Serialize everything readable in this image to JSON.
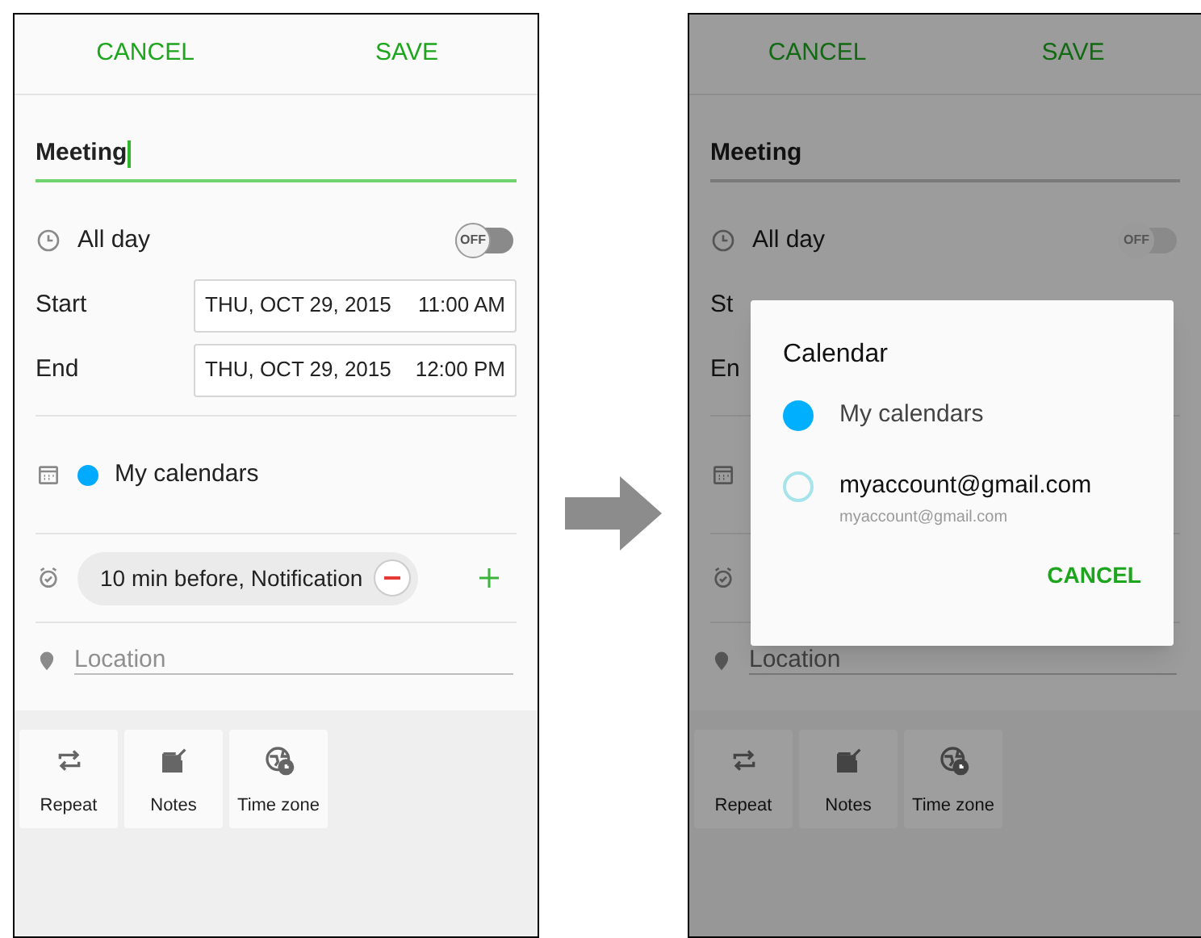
{
  "screens": [
    {
      "dimmed": false,
      "header": {
        "cancel": "CANCEL",
        "save": "SAVE"
      },
      "title": {
        "value": "Meeting",
        "focused": true
      },
      "all_day": {
        "label": "All day",
        "on": false,
        "toggle_text": "OFF"
      },
      "start": {
        "label": "Start",
        "date": "THU, OCT 29, 2015",
        "time": "11:00 AM"
      },
      "end": {
        "label": "End",
        "date": "THU, OCT 29, 2015",
        "time": "12:00 PM"
      },
      "calendar": {
        "label": "My calendars"
      },
      "reminder": {
        "text": "10 min before, Notification"
      },
      "location": {
        "placeholder": "Location"
      },
      "options": [
        {
          "label": "Repeat",
          "kind": "repeat"
        },
        {
          "label": "Notes",
          "kind": "notes"
        },
        {
          "label": "Time zone",
          "kind": "timezone"
        }
      ]
    },
    {
      "dimmed": true,
      "header": {
        "cancel": "CANCEL",
        "save": "SAVE"
      },
      "title": {
        "value": "Meeting",
        "focused": false
      },
      "all_day": {
        "label": "All day",
        "on": false,
        "toggle_text": "OFF"
      },
      "start": {
        "label": "St"
      },
      "end": {
        "label": "En"
      },
      "location": {
        "placeholder": "Location"
      },
      "options": [
        {
          "label": "Repeat",
          "kind": "repeat"
        },
        {
          "label": "Notes",
          "kind": "notes"
        },
        {
          "label": "Time zone",
          "kind": "timezone"
        }
      ],
      "dialog": {
        "title": "Calendar",
        "options": [
          {
            "label": "My calendars",
            "selected": true
          },
          {
            "label": "myaccount@gmail.com",
            "sublabel": "myaccount@gmail.com",
            "selected": false
          }
        ],
        "cancel": "CANCEL"
      }
    }
  ]
}
